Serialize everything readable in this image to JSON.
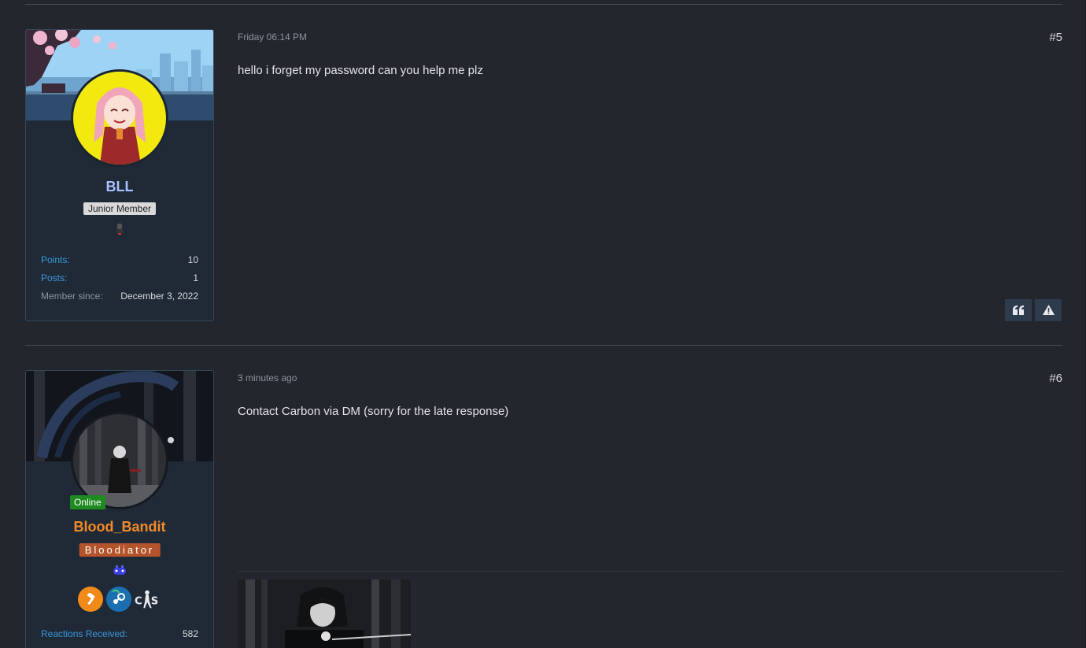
{
  "posts": [
    {
      "date": "Friday 06:14 PM",
      "number": "#5",
      "body": "hello i forget my password can you help me plz",
      "user": {
        "name": "BLL",
        "name_color": "#a9c1ff",
        "title": "Junior Member",
        "stats": [
          {
            "label": "Points:",
            "value": "10"
          },
          {
            "label": "Posts:",
            "value": "1"
          },
          {
            "label": "Member since:",
            "value": "December 3, 2022"
          }
        ]
      },
      "actions": [
        {
          "name": "quote-button",
          "icon": "quote-icon"
        },
        {
          "name": "report-button",
          "icon": "warning-icon"
        }
      ]
    },
    {
      "date": "3 minutes ago",
      "number": "#6",
      "body": "Contact Carbon via DM (sorry for the late response)",
      "user": {
        "name": "Blood_Bandit",
        "name_color": "#f28a28",
        "status": "Online",
        "title": "Bloodiator",
        "badges": [
          "hammer-icon",
          "steam-icon",
          "counter-strike-icon"
        ],
        "stats": [
          {
            "label": "Reactions Received:",
            "value": "582"
          }
        ]
      }
    }
  ]
}
